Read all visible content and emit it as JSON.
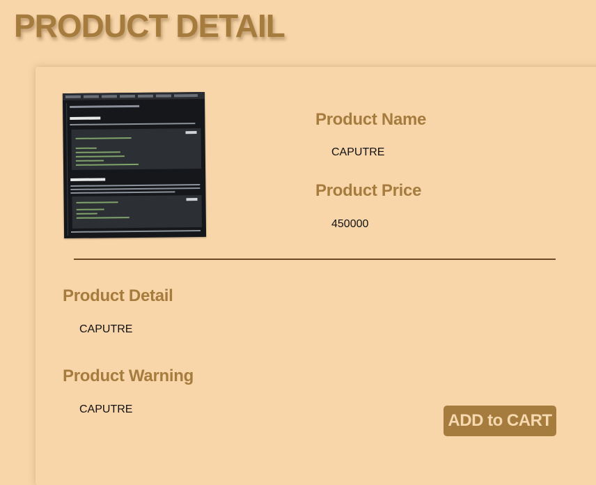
{
  "page": {
    "title": "PRODUCT DETAIL"
  },
  "product": {
    "image_icon": "product-thumbnail-screenshot",
    "name_label": "Product Name",
    "name_value": "CAPUTRE",
    "price_label": "Product Price",
    "price_value": "450000",
    "detail_label": "Product Detail",
    "detail_value": "CAPUTRE",
    "warning_label": "Product Warning",
    "warning_value": "CAPUTRE"
  },
  "actions": {
    "add_to_cart_label": "ADD to CART"
  },
  "colors": {
    "background": "#f8d6aa",
    "accent": "#a67c3e",
    "divider": "#6e4a24",
    "button_text": "#f6d9b0"
  }
}
